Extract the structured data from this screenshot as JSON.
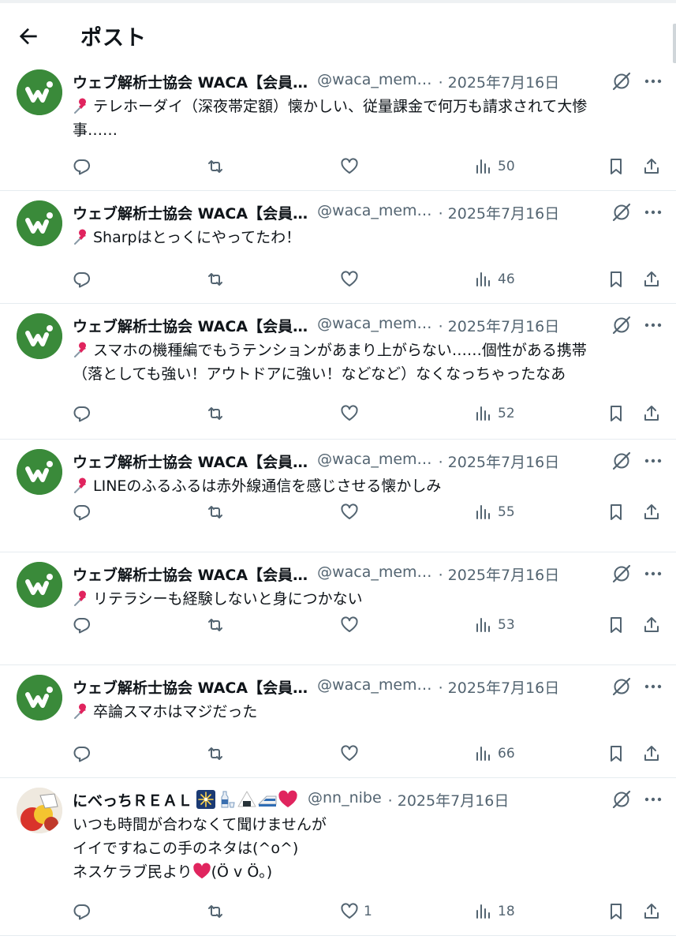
{
  "header": {
    "title": "ポスト",
    "back_icon": "arrow-left-icon"
  },
  "colors": {
    "text": "#0f1419",
    "secondary": "#536471",
    "divider": "#e6ecf0",
    "waca_green": "#3a8a3a",
    "heart_red": "#e0245e"
  },
  "tweets": [
    {
      "name": "ウェブ解析士協会 WACA【会員…",
      "handle": "@waca_mem…",
      "date": "· 2025年7月16日",
      "lines": [
        "テレホーダイ（深夜帯定額）懐かしい、従量課金で何万も請求されて大惨",
        "事……"
      ],
      "likes": "",
      "views": "50"
    },
    {
      "name": "ウェブ解析士協会 WACA【会員…",
      "handle": "@waca_mem…",
      "date": "· 2025年7月16日",
      "lines": [
        "Sharpはとっくにやってたわ！"
      ],
      "likes": "",
      "views": "46"
    },
    {
      "name": "ウェブ解析士協会 WACA【会員…",
      "handle": "@waca_mem…",
      "date": "· 2025年7月16日",
      "lines": [
        "スマホの機種編でもうテンションがあまり上がらない……個性がある携帯",
        "（落としても強い！アウトドアに強い！などなど）なくなっちゃったなあ"
      ],
      "likes": "",
      "views": "52"
    },
    {
      "name": "ウェブ解析士協会 WACA【会員…",
      "handle": "@waca_mem…",
      "date": "· 2025年7月16日",
      "lines": [
        "LINEのふるふるは赤外線通信を感じさせる懐かしみ"
      ],
      "likes": "",
      "views": "55"
    },
    {
      "name": "ウェブ解析士協会 WACA【会員…",
      "handle": "@waca_mem…",
      "date": "· 2025年7月16日",
      "lines": [
        "リテラシーも経験しないと身につかない"
      ],
      "likes": "",
      "views": "53"
    },
    {
      "name": "ウェブ解析士協会 WACA【会員…",
      "handle": "@waca_mem…",
      "date": "· 2025年7月16日",
      "lines": [
        "卒論スマホはマジだった"
      ],
      "likes": "",
      "views": "66"
    },
    {
      "name": "にべっちＲＥＡＬ",
      "name_emojis": [
        "fireworks-emoji",
        "sake-emoji",
        "onigiri-emoji",
        "shinkansen-emoji",
        "red-heart-emoji"
      ],
      "handle": "@nn_nibe",
      "date": "· 2025年7月16日",
      "lines": [
        "いつも時間が合わなくて聞けませんが",
        "イイですねこの手のネタは(^o^)",
        "ネスケラブ民より",
        "(Ö v Ö。)"
      ],
      "likes": "1",
      "views": "18"
    }
  ]
}
